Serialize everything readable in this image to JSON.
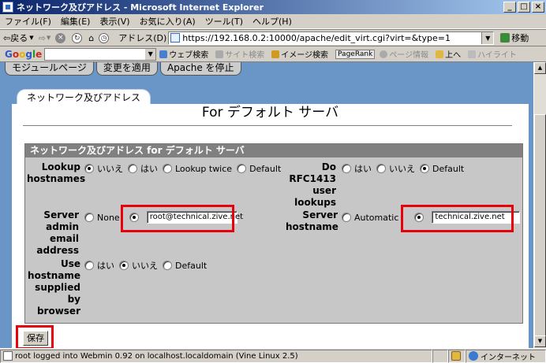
{
  "window": {
    "title": "ネットワーク及びアドレス - Microsoft Internet Explorer"
  },
  "menu": [
    "ファイル(F)",
    "編集(E)",
    "表示(V)",
    "お気に入り(A)",
    "ツール(T)",
    "ヘルプ(H)"
  ],
  "toolbar": {
    "back_label": "戻る",
    "address_label": "アドレス(D)",
    "url": "https://192.168.0.2:10000/apache/edit_virt.cgi?virt=&type=1",
    "go_label": "移動"
  },
  "google_bar": {
    "logo": [
      "G",
      "o",
      "o",
      "g",
      "l",
      "e"
    ],
    "web_search": "ウェブ検索",
    "site_search": "サイト検索",
    "image_search": "イメージ検索",
    "pagerank": "PageRank",
    "page_info": "ページ情報",
    "up": "上へ",
    "highlight": "ハイライト"
  },
  "top_tabs": [
    "モジュールページ",
    "変更を適用",
    "Apache を停止"
  ],
  "tab_header": "ネットワーク及びアドレス",
  "page_title": "For デフォルト サーバ",
  "form": {
    "header": "ネットワーク及びアドレス for デフォルト サーバ",
    "lookup_label": "Lookup hostnames",
    "lookup_options": [
      "いいえ",
      "はい",
      "Lookup twice",
      "Default"
    ],
    "do_rfc_label": "Do RFC1413 user lookups",
    "do_rfc_options": [
      "はい",
      "いいえ",
      "Default"
    ],
    "server_admin_label": "Server admin email address",
    "server_admin_none": "None",
    "server_admin_value": "root@technical.zive.net",
    "server_hostname_label": "Server hostname",
    "server_hostname_auto": "Automatic",
    "server_hostname_value": "technical.zive.net",
    "use_hostname_label": "Use hostname supplied by browser",
    "use_hostname_options": [
      "はい",
      "いいえ",
      "Default"
    ]
  },
  "save_label": "保存",
  "status": {
    "text": "root logged into Webmin 0.92 on localhost.localdomain (Vine Linux 2.5)",
    "zone": "インターネット"
  },
  "colors": {
    "accent_red": "#e8000b",
    "page_bg": "#6996c7",
    "title_bar": "#0a246a"
  }
}
